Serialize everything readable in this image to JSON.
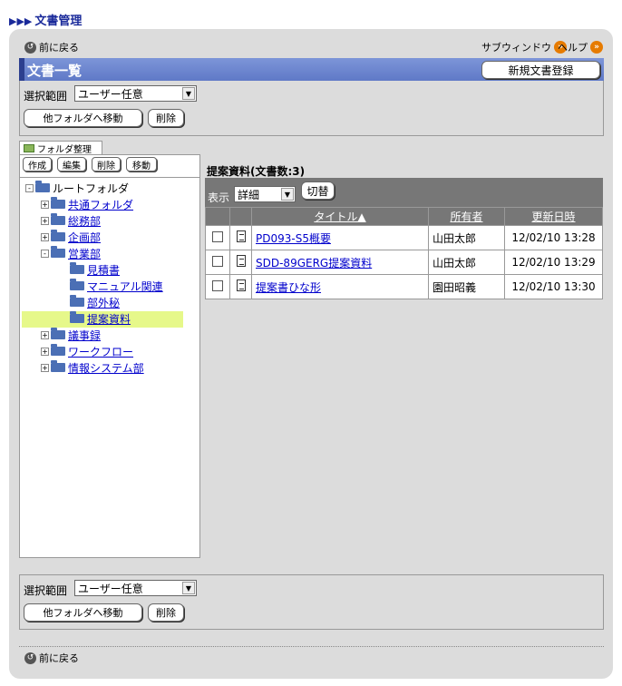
{
  "page_title": "文書管理",
  "top_links": {
    "back": "前に戻る",
    "subwindow": "サブウィンドウ",
    "help": "ヘルプ"
  },
  "section_title": "文書一覧",
  "new_doc_button": "新規文書登録",
  "filter": {
    "label": "選択範囲",
    "value": "ユーザー任意",
    "move_button": "他フォルダへ移動",
    "delete_button": "削除"
  },
  "folder_tab": "フォルダ整理",
  "folder_buttons": [
    "作成",
    "編集",
    "削除",
    "移動"
  ],
  "tree": {
    "root": "ルートフォルダ",
    "items": [
      {
        "label": "共通フォルダ",
        "expander": "+"
      },
      {
        "label": "総務部",
        "expander": "+"
      },
      {
        "label": "企画部",
        "expander": "+"
      },
      {
        "label": "営業部",
        "expander": "-"
      },
      {
        "label": "見積書",
        "expander": ""
      },
      {
        "label": "マニュアル関連",
        "expander": ""
      },
      {
        "label": "部外秘",
        "expander": ""
      },
      {
        "label": "提案資料",
        "expander": "",
        "selected": true
      },
      {
        "label": "議事録",
        "expander": "+"
      },
      {
        "label": "ワークフロー",
        "expander": "+"
      },
      {
        "label": "情報システム部",
        "expander": "+"
      }
    ]
  },
  "doc_list": {
    "heading": "提案資料(文書数:3)",
    "view_label": "表示",
    "view_value": "詳細",
    "switch_button": "切替",
    "columns": [
      "タイトル▲",
      "所有者",
      "更新日時"
    ],
    "rows": [
      {
        "title": "PD093-S5概要",
        "owner": "山田太郎",
        "updated": "12/02/10 13:28"
      },
      {
        "title": "SDD-89GERG提案資料",
        "owner": "山田太郎",
        "updated": "12/02/10 13:29"
      },
      {
        "title": "提案書ひな形",
        "owner": "園田昭義",
        "updated": "12/02/10 13:30"
      }
    ]
  },
  "bottom_filter": {
    "label": "選択範囲",
    "value": "ユーザー任意",
    "move_button": "他フォルダへ移動",
    "delete_button": "削除"
  },
  "bottom_back": "前に戻る"
}
